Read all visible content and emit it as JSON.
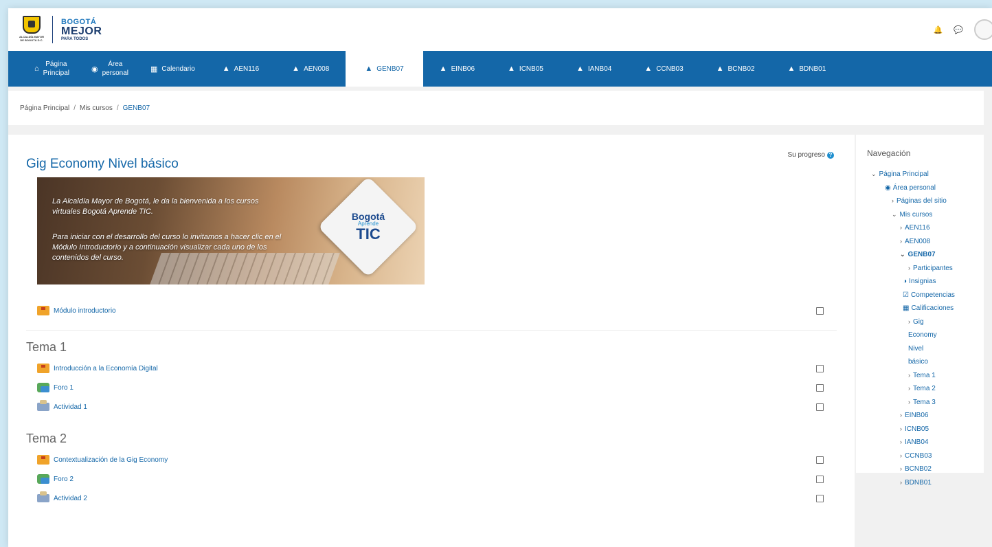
{
  "header": {
    "logo_seal_text": "ALCALDÍA MAYOR DE BOGOTÁ D.C.",
    "logo_line1": "BOGOTÁ",
    "logo_line2": "MEJOR",
    "logo_line3": "PARA TODOS"
  },
  "nav": {
    "items": [
      {
        "line1": "Página",
        "line2": "Principal",
        "icon": "home-icon"
      },
      {
        "line1": "Área",
        "line2": "personal",
        "icon": "dashboard-icon"
      },
      {
        "label": "Calendario",
        "icon": "calendar-icon"
      },
      {
        "label": "AEN116",
        "icon": "graduation-cap-icon"
      },
      {
        "label": "AEN008",
        "icon": "graduation-cap-icon"
      },
      {
        "label": "GENB07",
        "icon": "graduation-cap-icon",
        "active": true
      },
      {
        "label": "EINB06",
        "icon": "graduation-cap-icon"
      },
      {
        "label": "ICNB05",
        "icon": "graduation-cap-icon"
      },
      {
        "label": "IANB04",
        "icon": "graduation-cap-icon"
      },
      {
        "label": "CCNB03",
        "icon": "graduation-cap-icon"
      },
      {
        "label": "BCNB02",
        "icon": "graduation-cap-icon"
      },
      {
        "label": "BDNB01",
        "icon": "graduation-cap-icon"
      }
    ]
  },
  "breadcrumb": {
    "items": [
      "Página Principal",
      "Mis cursos",
      "GENB07"
    ]
  },
  "course": {
    "title": "Gig Economy Nivel básico",
    "progress_label": "Su progreso",
    "banner": {
      "p1": "La Alcaldía Mayor de Bogotá, le da la bienvenida a los cursos virtuales Bogotá Aprende TIC.",
      "p2": "Para iniciar con el desarrollo del curso lo invitamos a hacer clic en el Módulo Introductorio y a continuación visualizar cada uno de los contenidos del curso.",
      "badge_line1": "Bogotá",
      "badge_line2": "Aprende",
      "badge_line3": "TIC"
    },
    "intro_activity": "Módulo introductorio",
    "sections": [
      {
        "title": "Tema 1",
        "activities": [
          {
            "label": "Introducción a la Economía Digital",
            "type": "folder"
          },
          {
            "label": "Foro 1",
            "type": "forum"
          },
          {
            "label": "Actividad 1",
            "type": "assign"
          }
        ]
      },
      {
        "title": "Tema 2",
        "activities": [
          {
            "label": "Contextualización de la Gig Economy",
            "type": "folder"
          },
          {
            "label": "Foro 2",
            "type": "forum"
          },
          {
            "label": "Actividad 2",
            "type": "assign"
          }
        ]
      }
    ]
  },
  "navigation": {
    "title": "Navegación",
    "items": [
      {
        "label": "Página Principal",
        "caret": "⌄"
      },
      {
        "label": "Área personal",
        "caret": ""
      },
      {
        "label": "Páginas del sitio",
        "caret": "›"
      },
      {
        "label": "Mis cursos",
        "caret": "⌄"
      },
      {
        "label": "AEN116",
        "caret": "›"
      },
      {
        "label": "AEN008",
        "caret": "›"
      },
      {
        "label": "GENB07",
        "caret": "⌄"
      },
      {
        "label": "Participantes",
        "caret": "›"
      },
      {
        "label": "Insignias",
        "caret": ""
      },
      {
        "label": "Competencias",
        "caret": ""
      },
      {
        "label": "Calificaciones",
        "caret": ""
      },
      {
        "label": "Gig Economy Nivel básico",
        "caret": "›"
      },
      {
        "label": "Tema 1",
        "caret": "›"
      },
      {
        "label": "Tema 2",
        "caret": "›"
      },
      {
        "label": "Tema 3",
        "caret": "›"
      },
      {
        "label": "EINB06",
        "caret": "›"
      },
      {
        "label": "ICNB05",
        "caret": "›"
      },
      {
        "label": "IANB04",
        "caret": "›"
      },
      {
        "label": "CCNB03",
        "caret": "›"
      },
      {
        "label": "BCNB02",
        "caret": "›"
      },
      {
        "label": "BDNB01",
        "caret": "›"
      }
    ]
  },
  "colors": {
    "brand_blue": "#1467a8",
    "page_bg": "#f1f1f1",
    "frame_bg": "#cfe8f4"
  }
}
